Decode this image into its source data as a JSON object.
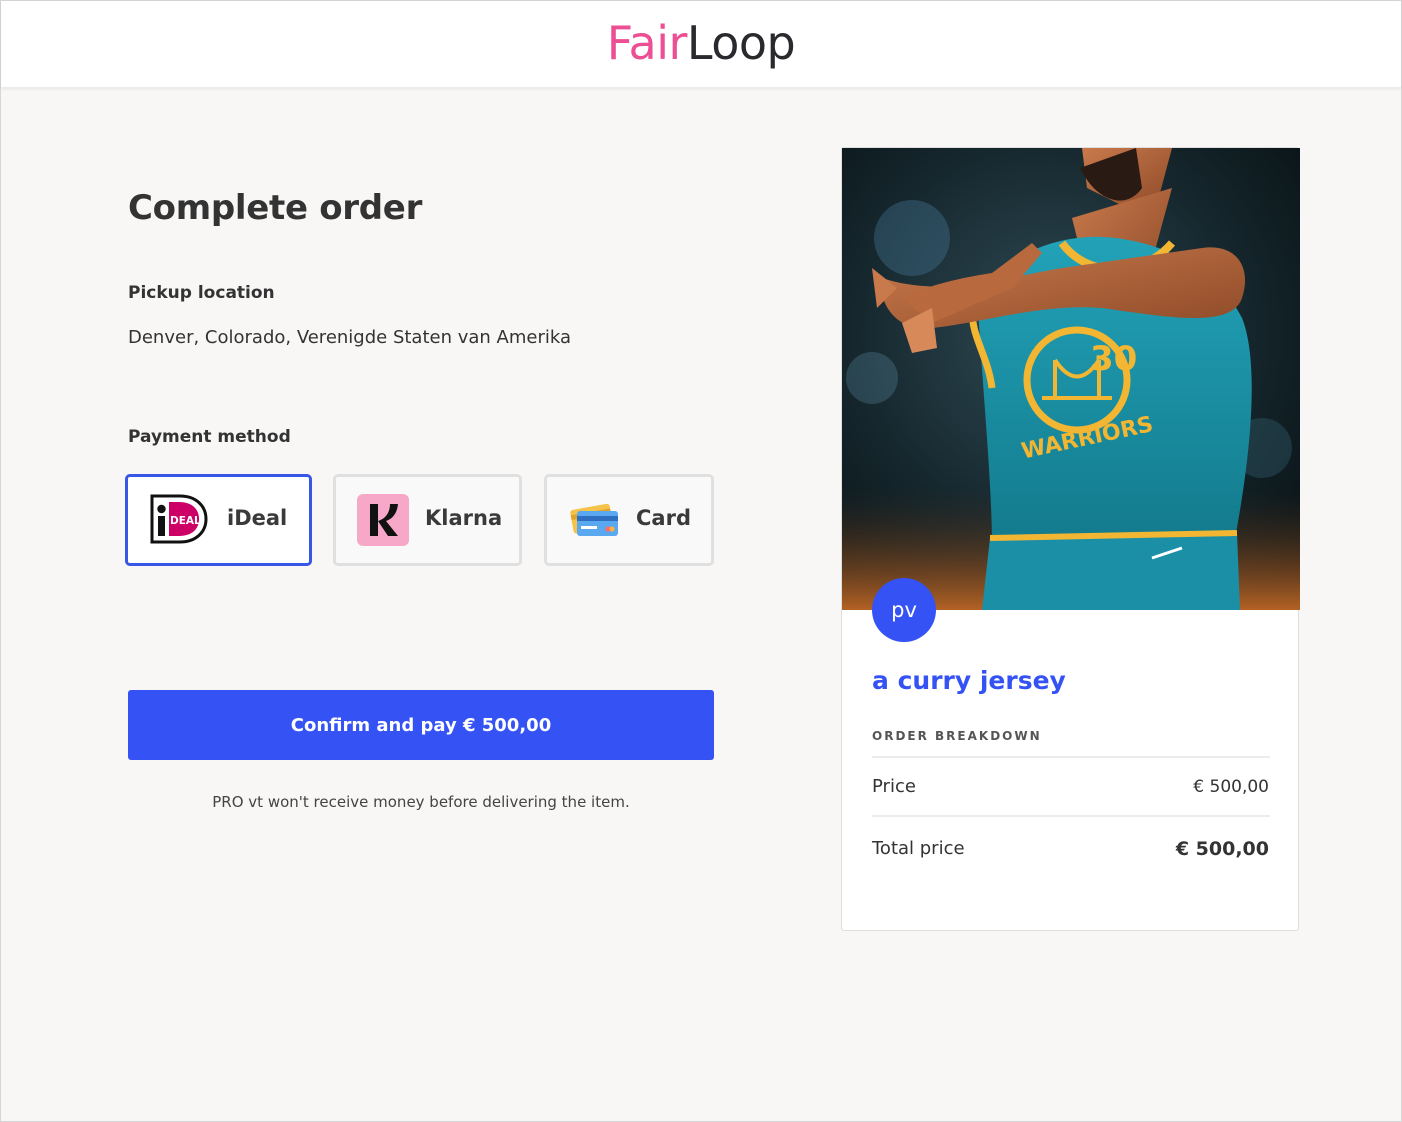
{
  "brand": {
    "part1": "Fair",
    "part2": "Loop",
    "accent": "#ec4f93",
    "primary": "#3553f5"
  },
  "checkout": {
    "title": "Complete order",
    "pickup_label": "Pickup location",
    "pickup_value": "Denver, Colorado, Verenigde Staten van Amerika",
    "payment_label": "Payment method",
    "methods": [
      {
        "label": "iDeal",
        "icon": "ideal-logo-icon",
        "selected": true
      },
      {
        "label": "Klarna",
        "icon": "klarna-logo-icon",
        "selected": false
      },
      {
        "label": "Card",
        "icon": "credit-card-icon",
        "selected": false
      }
    ],
    "confirm_label": "Confirm and pay € 500,00",
    "disclaimer": "PRO vt won't receive money before delivering the item."
  },
  "product": {
    "seller_initials": "pv",
    "title": "a curry jersey",
    "photo_jersey_text": "WARRIORS",
    "photo_jersey_number": "30",
    "breakdown_heading": "ORDER BREAKDOWN",
    "price_label": "Price",
    "price_value": "€ 500,00",
    "total_label": "Total price",
    "total_value": "€ 500,00"
  }
}
